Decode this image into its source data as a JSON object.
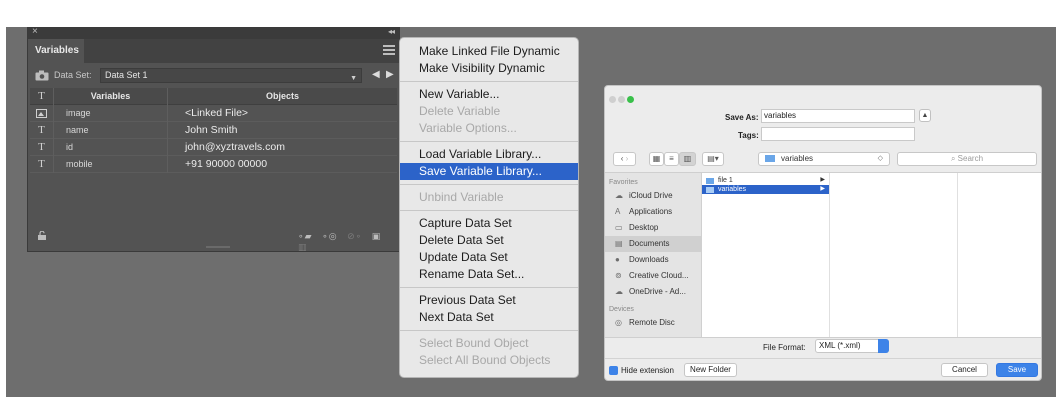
{
  "variables_panel": {
    "tab_label": "Variables",
    "dataset_label": "Data Set:",
    "dataset_value": "Data Set 1",
    "columns": {
      "type": "T",
      "variables": "Variables",
      "objects": "Objects"
    },
    "rows": [
      {
        "type_icon": "image-icon",
        "name": "image",
        "object": "<Linked File>"
      },
      {
        "type_icon": "text-icon",
        "type_glyph": "T",
        "name": "name",
        "object": "John Smith"
      },
      {
        "type_icon": "text-icon",
        "type_glyph": "T",
        "name": "id",
        "object": "john@xyztravels.com"
      },
      {
        "type_icon": "text-icon",
        "type_glyph": "T",
        "name": "mobile",
        "object": "+91 90000 00000"
      }
    ]
  },
  "flyout_menu": {
    "groups": [
      [
        {
          "label": "Make Linked File Dynamic",
          "enabled": true
        },
        {
          "label": "Make Visibility Dynamic",
          "enabled": true
        }
      ],
      [
        {
          "label": "New Variable...",
          "enabled": true
        },
        {
          "label": "Delete Variable",
          "enabled": false
        },
        {
          "label": "Variable Options...",
          "enabled": false
        }
      ],
      [
        {
          "label": "Load Variable Library...",
          "enabled": true
        },
        {
          "label": "Save Variable Library...",
          "enabled": true,
          "selected": true
        }
      ],
      [
        {
          "label": "Unbind Variable",
          "enabled": false
        }
      ],
      [
        {
          "label": "Capture Data Set",
          "enabled": true
        },
        {
          "label": "Delete Data Set",
          "enabled": true
        },
        {
          "label": "Update Data Set",
          "enabled": true
        },
        {
          "label": "Rename Data Set...",
          "enabled": true
        }
      ],
      [
        {
          "label": "Previous Data Set",
          "enabled": true
        },
        {
          "label": "Next Data Set",
          "enabled": true
        }
      ],
      [
        {
          "label": "Select Bound Object",
          "enabled": false
        },
        {
          "label": "Select All Bound Objects",
          "enabled": false
        }
      ]
    ]
  },
  "save_dialog": {
    "save_as_label": "Save As:",
    "save_as_value": "variables",
    "tags_label": "Tags:",
    "location": "variables",
    "search_placeholder": "Search",
    "sidebar": {
      "favorites_heading": "Favorites",
      "favorites": [
        {
          "icon": "cloud-icon",
          "glyph": "☁",
          "label": "iCloud Drive"
        },
        {
          "icon": "applications-icon",
          "glyph": "A",
          "label": "Applications"
        },
        {
          "icon": "desktop-icon",
          "glyph": "▭",
          "label": "Desktop"
        },
        {
          "icon": "documents-icon",
          "glyph": "▤",
          "label": "Documents",
          "selected": true
        },
        {
          "icon": "downloads-icon",
          "glyph": "●",
          "label": "Downloads"
        },
        {
          "icon": "creative-cloud-icon",
          "glyph": "⊚",
          "label": "Creative Cloud..."
        },
        {
          "icon": "onedrive-icon",
          "glyph": "☁",
          "label": "OneDrive - Ad..."
        }
      ],
      "devices_heading": "Devices",
      "devices": [
        {
          "icon": "disc-icon",
          "glyph": "◎",
          "label": "Remote Disc"
        }
      ]
    },
    "files": [
      {
        "name": "file 1",
        "selected": false
      },
      {
        "name": "variables",
        "selected": true
      }
    ],
    "file_format_label": "File Format:",
    "file_format_value": "XML (*.xml)",
    "hide_extension_label": "Hide extension",
    "new_folder_label": "New Folder",
    "cancel_label": "Cancel",
    "save_label": "Save",
    "accent_color": "#3d83e8"
  }
}
